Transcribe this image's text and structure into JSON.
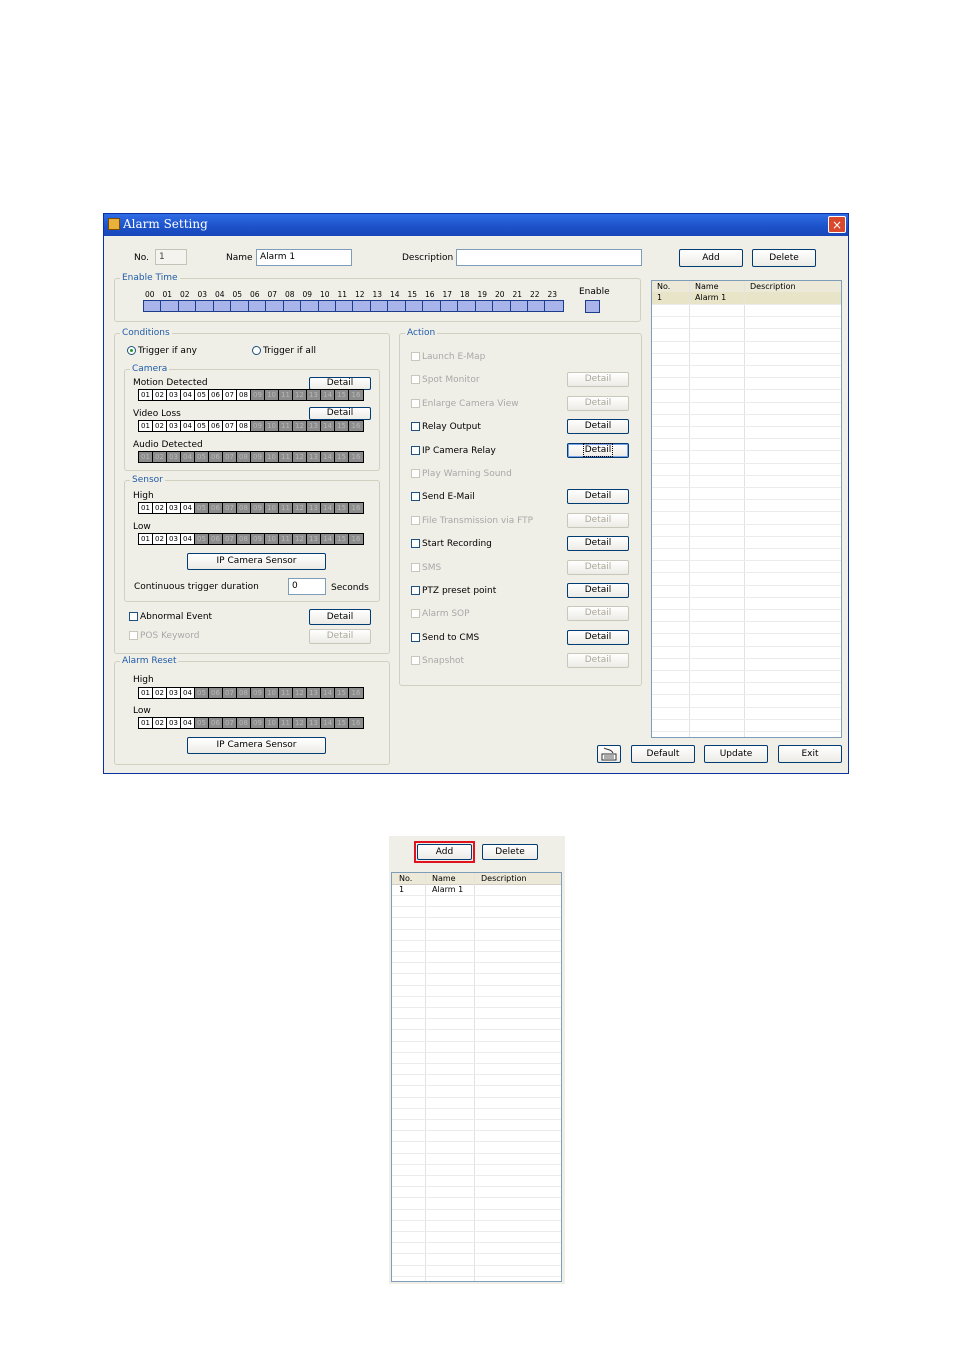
{
  "window": {
    "title": "Alarm Setting",
    "close": "×"
  },
  "header": {
    "no_label": "No.",
    "no_value": "1",
    "name_label": "Name",
    "name_value": "Alarm 1",
    "desc_label": "Description",
    "desc_value": "",
    "add": "Add",
    "delete": "Delete"
  },
  "enable_time": {
    "title": "Enable Time",
    "hours": [
      "00",
      "01",
      "02",
      "03",
      "04",
      "05",
      "06",
      "07",
      "08",
      "09",
      "10",
      "11",
      "12",
      "13",
      "14",
      "15",
      "16",
      "17",
      "18",
      "19",
      "20",
      "21",
      "22",
      "23"
    ],
    "enable_label": "Enable"
  },
  "conditions": {
    "title": "Conditions",
    "trigger_any": "Trigger if any",
    "trigger_all": "Trigger if all",
    "camera": {
      "title": "Camera",
      "motion": "Motion Detected",
      "video_loss": "Video Loss",
      "audio": "Audio Detected",
      "detail": "Detail"
    },
    "channels16": [
      "01",
      "02",
      "03",
      "04",
      "05",
      "06",
      "07",
      "08",
      "09",
      "10",
      "11",
      "12",
      "13",
      "14",
      "15",
      "16"
    ],
    "sensor": {
      "title": "Sensor",
      "high": "High",
      "low": "Low",
      "ip_sensor": "IP Camera Sensor",
      "duration_label": "Continuous trigger duration",
      "duration_value": "0",
      "seconds": "Seconds"
    },
    "abnormal": "Abnormal Event",
    "pos": "POS Keyword",
    "detail": "Detail"
  },
  "alarm_reset": {
    "title": "Alarm Reset",
    "high": "High",
    "low": "Low",
    "ip_sensor": "IP Camera Sensor"
  },
  "action": {
    "title": "Action",
    "items": [
      {
        "label": "Launch E-Map",
        "enabled": false,
        "detail": false
      },
      {
        "label": "Spot Monitor",
        "enabled": false,
        "detail": true
      },
      {
        "label": "Enlarge Camera View",
        "enabled": false,
        "detail": true
      },
      {
        "label": "Relay Output",
        "enabled": true,
        "detail": true
      },
      {
        "label": "IP Camera Relay",
        "enabled": true,
        "detail": true
      },
      {
        "label": "Play Warning Sound",
        "enabled": false,
        "detail": false
      },
      {
        "label": "Send E-Mail",
        "enabled": true,
        "detail": true
      },
      {
        "label": "File Transmission via FTP",
        "enabled": false,
        "detail": true
      },
      {
        "label": "Start Recording",
        "enabled": true,
        "detail": true
      },
      {
        "label": "SMS",
        "enabled": false,
        "detail": true
      },
      {
        "label": "PTZ preset point",
        "enabled": true,
        "detail": true
      },
      {
        "label": "Alarm SOP",
        "enabled": false,
        "detail": true
      },
      {
        "label": "Send to CMS",
        "enabled": true,
        "detail": true
      },
      {
        "label": "Snapshot",
        "enabled": false,
        "detail": true
      }
    ],
    "detail": "Detail"
  },
  "alarm_list": {
    "columns": [
      "No.",
      "Name",
      "Description"
    ],
    "rows": [
      {
        "no": "1",
        "name": "Alarm 1",
        "desc": ""
      }
    ]
  },
  "footer": {
    "default": "Default",
    "update": "Update",
    "exit": "Exit"
  },
  "zoom_panel": {
    "add": "Add",
    "delete": "Delete",
    "columns": [
      "No.",
      "Name",
      "Description"
    ],
    "row_no": "1",
    "row_name": "Alarm 1"
  },
  "colors": {
    "title_bar": "#1c51c9",
    "highlight": "#e0141e",
    "timeline": "#a9b4ea"
  }
}
